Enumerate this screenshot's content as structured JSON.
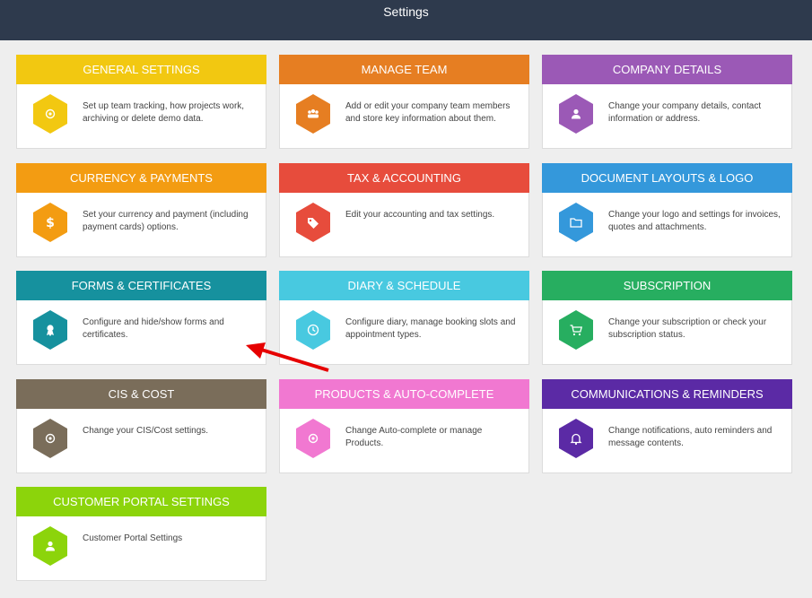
{
  "header": {
    "title": "Settings"
  },
  "cards": [
    {
      "title": "GENERAL SETTINGS",
      "desc": "Set up team tracking, how projects work, archiving or delete demo data.",
      "color": "#f2c811",
      "icon": "gear-icon"
    },
    {
      "title": "MANAGE TEAM",
      "desc": "Add or edit your company team members and store key information about them.",
      "color": "#e67e22",
      "icon": "team-icon"
    },
    {
      "title": "COMPANY DETAILS",
      "desc": "Change your company details, contact information or address.",
      "color": "#9b59b6",
      "icon": "person-icon"
    },
    {
      "title": "CURRENCY & PAYMENTS",
      "desc": "Set your currency and payment (including payment cards) options.",
      "color": "#f39c12",
      "icon": "dollar-icon"
    },
    {
      "title": "TAX & ACCOUNTING",
      "desc": "Edit your accounting and tax settings.",
      "color": "#e74c3c",
      "icon": "tag-icon"
    },
    {
      "title": "DOCUMENT LAYOUTS & LOGO",
      "desc": "Change your logo and settings for invoices, quotes and attachments.",
      "color": "#3498db",
      "icon": "folder-icon"
    },
    {
      "title": "FORMS & CERTIFICATES",
      "desc": "Configure and hide/show forms and certificates.",
      "color": "#16919e",
      "icon": "award-icon"
    },
    {
      "title": "DIARY & SCHEDULE",
      "desc": "Configure diary, manage booking slots and appointment types.",
      "color": "#48c9e0",
      "icon": "clock-icon"
    },
    {
      "title": "SUBSCRIPTION",
      "desc": "Change your subscription or check your subscription status.",
      "color": "#27ae60",
      "icon": "cart-icon"
    },
    {
      "title": "CIS & COST",
      "desc": "Change your CIS/Cost settings.",
      "color": "#7a6d5a",
      "icon": "gear-icon"
    },
    {
      "title": "PRODUCTS & AUTO-COMPLETE",
      "desc": "Change Auto-complete or manage Products.",
      "color": "#f178d1",
      "icon": "gear-icon"
    },
    {
      "title": "COMMUNICATIONS & REMINDERS",
      "desc": "Change notifications, auto reminders and message contents.",
      "color": "#5b2aa5",
      "icon": "bell-icon"
    },
    {
      "title": "CUSTOMER PORTAL SETTINGS",
      "desc": "Customer Portal Settings",
      "color": "#8cd40b",
      "icon": "person-icon"
    }
  ],
  "annotation": {
    "arrow_color": "#e60000"
  }
}
